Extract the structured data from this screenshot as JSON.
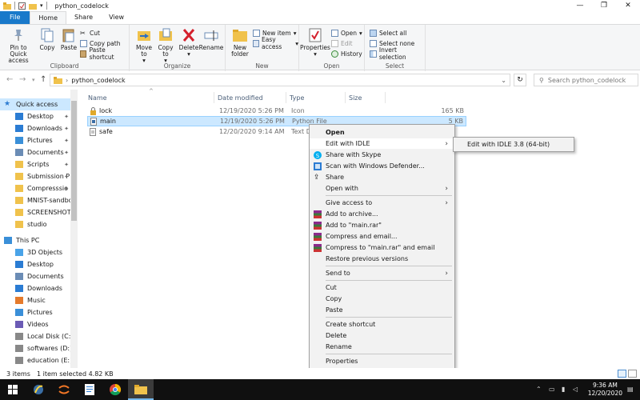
{
  "window": {
    "title": "python_codelock"
  },
  "tabs": [
    "File",
    "Home",
    "Share",
    "View"
  ],
  "ribbon": {
    "clipboard": {
      "pin": "Pin to Quick access",
      "copy": "Copy",
      "paste": "Paste",
      "cut": "Cut",
      "copy_path": "Copy path",
      "paste_shortcut": "Paste shortcut",
      "label": "Clipboard"
    },
    "organize": {
      "move_to": "Move to",
      "copy_to": "Copy to",
      "delete": "Delete",
      "rename": "Rename",
      "label": "Organize"
    },
    "new": {
      "new_folder": "New folder",
      "new_item": "New item",
      "easy_access": "Easy access",
      "label": "New"
    },
    "open": {
      "properties": "Properties",
      "open": "Open",
      "edit": "Edit",
      "history": "History",
      "label": "Open"
    },
    "select": {
      "select_all": "Select all",
      "select_none": "Select none",
      "invert": "Invert selection",
      "label": "Select"
    }
  },
  "address": {
    "path": "python_codelock",
    "search_placeholder": "Search python_codelock"
  },
  "nav": {
    "quick_access": "Quick access",
    "quick_items": [
      "Desktop",
      "Downloads",
      "Pictures",
      "Documents",
      "Scripts",
      "Submission P",
      "Compresssio",
      "MNIST-sandbox",
      "SCREENSHOTS",
      "studio"
    ],
    "this_pc": "This PC",
    "pc_items": [
      "3D Objects",
      "Desktop",
      "Documents",
      "Downloads",
      "Music",
      "Pictures",
      "Videos",
      "Local Disk (C:)",
      "softwares (D:)",
      "education (E:)"
    ]
  },
  "columns": {
    "name": "Name",
    "date": "Date modified",
    "type": "Type",
    "size": "Size"
  },
  "files": [
    {
      "name": "lock",
      "date": "12/19/2020 5:26 PM",
      "type": "Icon",
      "size": "165 KB"
    },
    {
      "name": "main",
      "date": "12/19/2020 5:26 PM",
      "type": "Python File",
      "size": "5 KB"
    },
    {
      "name": "safe",
      "date": "12/20/2020 9:14 AM",
      "type": "Text D",
      "size": ""
    }
  ],
  "context_menu": {
    "open": "Open",
    "edit_idle": "Edit with IDLE",
    "share_skype": "Share with Skype",
    "scan_defender": "Scan with Windows Defender...",
    "share": "Share",
    "open_with": "Open with",
    "give_access": "Give access to",
    "add_archive": "Add to archive...",
    "add_rar": "Add to \"main.rar\"",
    "compress_email": "Compress and email...",
    "compress_rar_email": "Compress to \"main.rar\" and email",
    "restore": "Restore previous versions",
    "send_to": "Send to",
    "cut": "Cut",
    "copy": "Copy",
    "paste": "Paste",
    "create_shortcut": "Create shortcut",
    "delete": "Delete",
    "rename": "Rename",
    "properties": "Properties"
  },
  "submenu": {
    "idle_64": "Edit with IDLE 3.8 (64-bit)"
  },
  "status": {
    "count": "3 items",
    "selected": "1 item selected  4.82 KB"
  },
  "taskbar": {
    "time": "9:36 AM",
    "date": "12/20/2020"
  },
  "colors": {
    "accent": "#1979ca",
    "selection": "#cce8ff",
    "taskbar": "#101010"
  }
}
